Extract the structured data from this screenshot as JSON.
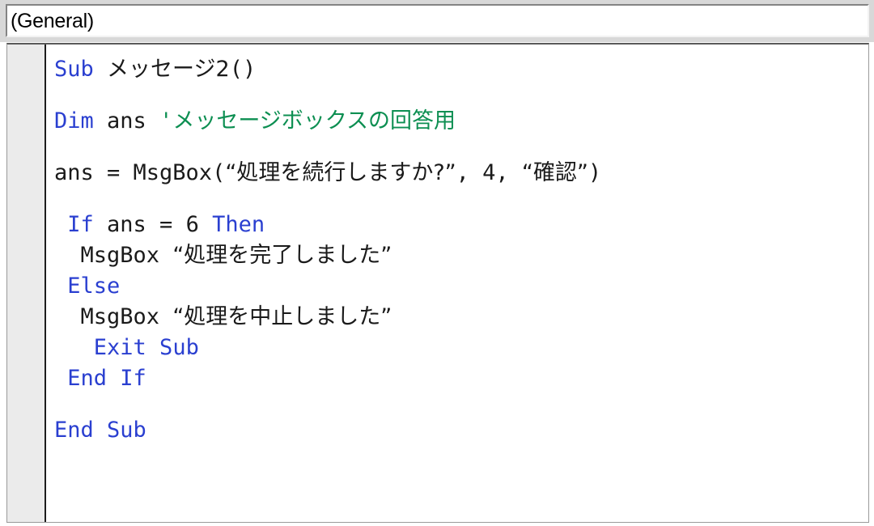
{
  "window": {
    "app": "vba-code-editor"
  },
  "dropdown": {
    "selected": "(General)",
    "options": [
      "(General)"
    ]
  },
  "editor": {
    "language": "VBA",
    "colors": {
      "keyword": "#2a3fd0",
      "comment": "#0d8f52",
      "text": "#1a1a1a",
      "background": "#ffffff",
      "gutter": "#ebebeb"
    },
    "lines": [
      {
        "type": "code",
        "segments": [
          {
            "t": "kw",
            "s": "Sub"
          },
          {
            "t": "txt",
            "s": " "
          },
          {
            "t": "jp",
            "s": "メッセージ2"
          },
          {
            "t": "txt",
            "s": "()"
          }
        ]
      },
      {
        "type": "blank",
        "segments": []
      },
      {
        "type": "code",
        "segments": [
          {
            "t": "kw",
            "s": "Dim"
          },
          {
            "t": "txt",
            "s": " ans "
          },
          {
            "t": "cmt",
            "s": "'"
          },
          {
            "t": "cmt jp",
            "s": "メッセージボックスの回答用"
          }
        ]
      },
      {
        "type": "blank",
        "segments": []
      },
      {
        "type": "code",
        "segments": [
          {
            "t": "txt",
            "s": "ans = MsgBox("
          },
          {
            "t": "jp",
            "s": "“処理を続行しますか?”"
          },
          {
            "t": "txt",
            "s": ", 4, "
          },
          {
            "t": "jp",
            "s": "“確認”"
          },
          {
            "t": "txt",
            "s": ")"
          }
        ]
      },
      {
        "type": "blank",
        "segments": []
      },
      {
        "type": "code",
        "segments": [
          {
            "t": "txt",
            "s": " "
          },
          {
            "t": "kw",
            "s": "If"
          },
          {
            "t": "txt",
            "s": " ans = 6 "
          },
          {
            "t": "kw",
            "s": "Then"
          }
        ]
      },
      {
        "type": "code",
        "segments": [
          {
            "t": "txt",
            "s": "  MsgBox "
          },
          {
            "t": "jp",
            "s": "“処理を完了しました”"
          }
        ]
      },
      {
        "type": "code",
        "segments": [
          {
            "t": "txt",
            "s": " "
          },
          {
            "t": "kw",
            "s": "Else"
          }
        ]
      },
      {
        "type": "code",
        "segments": [
          {
            "t": "txt",
            "s": "  MsgBox "
          },
          {
            "t": "jp",
            "s": "“処理を中止しました”"
          }
        ]
      },
      {
        "type": "code",
        "segments": [
          {
            "t": "txt",
            "s": "   "
          },
          {
            "t": "kw",
            "s": "Exit Sub"
          }
        ]
      },
      {
        "type": "code",
        "segments": [
          {
            "t": "txt",
            "s": " "
          },
          {
            "t": "kw",
            "s": "End If"
          }
        ]
      },
      {
        "type": "blank",
        "segments": []
      },
      {
        "type": "code",
        "segments": [
          {
            "t": "kw",
            "s": "End Sub"
          }
        ]
      }
    ]
  }
}
